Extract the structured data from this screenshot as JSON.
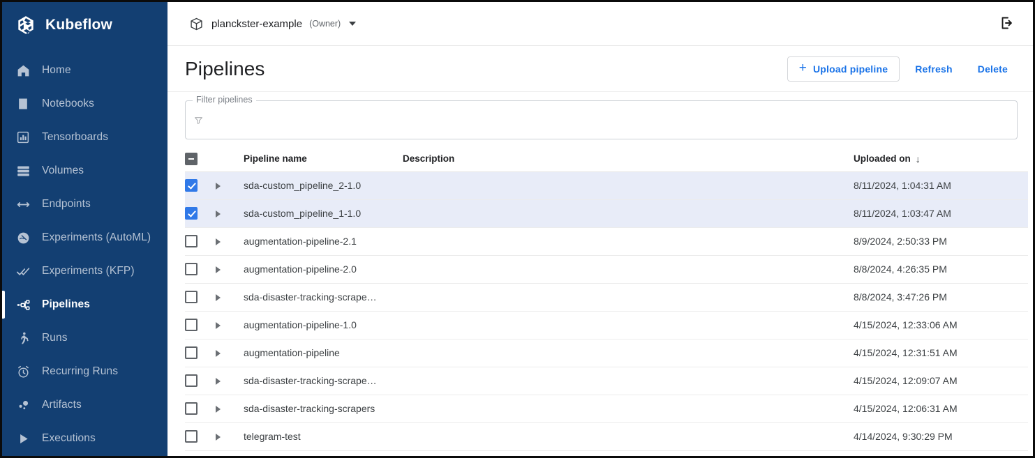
{
  "brand": {
    "name": "Kubeflow",
    "logo_icon": "kubeflow-logo-icon"
  },
  "sidebar": {
    "items": [
      {
        "label": "Home",
        "icon": "home-icon",
        "active": false
      },
      {
        "label": "Notebooks",
        "icon": "notebook-icon",
        "active": false
      },
      {
        "label": "Tensorboards",
        "icon": "bar-chart-icon",
        "active": false
      },
      {
        "label": "Volumes",
        "icon": "storage-icon",
        "active": false
      },
      {
        "label": "Endpoints",
        "icon": "code-arrows-icon",
        "active": false
      },
      {
        "label": "Experiments (AutoML)",
        "icon": "experiment-flask-icon",
        "active": false
      },
      {
        "label": "Experiments (KFP)",
        "icon": "double-check-icon",
        "active": false
      },
      {
        "label": "Pipelines",
        "icon": "pipeline-graph-icon",
        "active": true
      },
      {
        "label": "Runs",
        "icon": "runner-icon",
        "active": false
      },
      {
        "label": "Recurring Runs",
        "icon": "alarm-clock-icon",
        "active": false
      },
      {
        "label": "Artifacts",
        "icon": "artifacts-dots-icon",
        "active": false
      },
      {
        "label": "Executions",
        "icon": "play-triangle-icon",
        "active": false
      }
    ]
  },
  "topbar": {
    "namespace_icon": "package-cube-icon",
    "namespace": "planckster-example",
    "namespace_role": "(Owner)",
    "caret_icon": "chevron-down-icon",
    "logout_icon": "logout-icon"
  },
  "page": {
    "title": "Pipelines",
    "upload_label": "Upload pipeline",
    "upload_plus": "+",
    "refresh_label": "Refresh",
    "delete_label": "Delete"
  },
  "filter": {
    "legend": "Filter pipelines",
    "placeholder": "",
    "value": "",
    "icon": "filter-funnel-icon"
  },
  "table": {
    "columns": {
      "pipeline_name": "Pipeline name",
      "description": "Description",
      "uploaded_on": "Uploaded on"
    },
    "sort_arrow": "↓",
    "sort_direction": "descending",
    "header_checkbox_state": "indeterminate",
    "rows": [
      {
        "selected": true,
        "name": "sda-custom_pipeline_2-1.0",
        "description": "",
        "uploaded_on": "8/11/2024, 1:04:31 AM"
      },
      {
        "selected": true,
        "name": "sda-custom_pipeline_1-1.0",
        "description": "",
        "uploaded_on": "8/11/2024, 1:03:47 AM"
      },
      {
        "selected": false,
        "name": "augmentation-pipeline-2.1",
        "description": "",
        "uploaded_on": "8/9/2024, 2:50:33 PM"
      },
      {
        "selected": false,
        "name": "augmentation-pipeline-2.0",
        "description": "",
        "uploaded_on": "8/8/2024, 4:26:35 PM"
      },
      {
        "selected": false,
        "name": "sda-disaster-tracking-scrape…",
        "description": "",
        "uploaded_on": "8/8/2024, 3:47:26 PM"
      },
      {
        "selected": false,
        "name": "augmentation-pipeline-1.0",
        "description": "",
        "uploaded_on": "4/15/2024, 12:33:06 AM"
      },
      {
        "selected": false,
        "name": "augmentation-pipeline",
        "description": "",
        "uploaded_on": "4/15/2024, 12:31:51 AM"
      },
      {
        "selected": false,
        "name": "sda-disaster-tracking-scrape…",
        "description": "",
        "uploaded_on": "4/15/2024, 12:09:07 AM"
      },
      {
        "selected": false,
        "name": "sda-disaster-tracking-scrapers",
        "description": "",
        "uploaded_on": "4/15/2024, 12:06:31 AM"
      },
      {
        "selected": false,
        "name": "telegram-test",
        "description": "",
        "uploaded_on": "4/14/2024, 9:30:29 PM"
      }
    ]
  },
  "colors": {
    "sidebar_bg": "#133f72",
    "accent_blue": "#1a73e8",
    "checkbox_blue": "#3079e8",
    "selected_row_bg": "#e8ecf8",
    "sidebar_text": "#b6c3d4"
  }
}
